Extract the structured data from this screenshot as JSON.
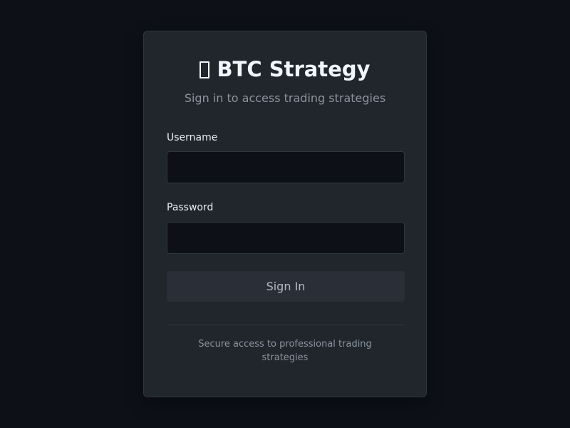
{
  "login": {
    "title": "BTC Strategy",
    "logo_icon": "chart-icon",
    "subtitle": "Sign in to access trading strategies",
    "username_label": "Username",
    "username_value": "",
    "password_label": "Password",
    "password_value": "",
    "submit_label": "Sign In",
    "footer_text": "Secure access to professional trading strategies"
  },
  "colors": {
    "background": "#0d1117",
    "card": "#21262d",
    "input_bg": "#0d1117",
    "button_bg": "#2a2f37",
    "muted_text": "#8b949e"
  }
}
